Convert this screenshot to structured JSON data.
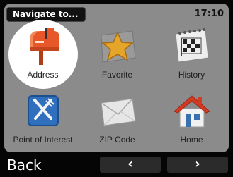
{
  "header": {
    "title": "Navigate to...",
    "time": "17:10"
  },
  "menu": {
    "items": [
      {
        "label": "Address",
        "icon": "mailbox-icon",
        "selected": true
      },
      {
        "label": "Favorite",
        "icon": "star-icon",
        "selected": false
      },
      {
        "label": "History",
        "icon": "calendar-flag-icon",
        "selected": false
      },
      {
        "label": "Point of Interest",
        "icon": "fork-knife-icon",
        "selected": false
      },
      {
        "label": "ZIP Code",
        "icon": "envelope-icon",
        "selected": false
      },
      {
        "label": "Home",
        "icon": "house-icon",
        "selected": false
      }
    ]
  },
  "footer": {
    "back_label": "Back",
    "prev_label": "‹",
    "next_label": "›"
  },
  "colors": {
    "screen_background": "#8b8b8b",
    "selection": "#ffffff",
    "accent_orange": "#e8572a",
    "poi_blue": "#2f6fbd",
    "home_red": "#d23a22"
  }
}
